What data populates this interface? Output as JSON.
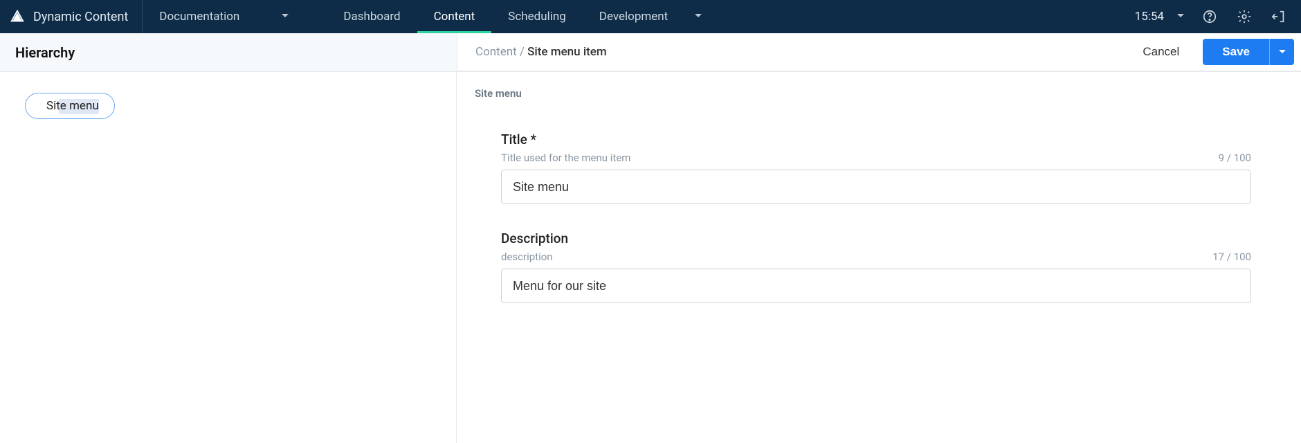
{
  "nav": {
    "brand": "Dynamic Content",
    "hub": "Documentation",
    "tabs": {
      "dashboard": "Dashboard",
      "content": "Content",
      "scheduling": "Scheduling",
      "development": "Development"
    },
    "clock": "15:54"
  },
  "sidebar": {
    "title": "Hierarchy",
    "node_label": "Site menu"
  },
  "editor": {
    "breadcrumb_root": "Content",
    "breadcrumb_current": "Site menu item",
    "cancel_label": "Cancel",
    "save_label": "Save",
    "schema_label": "Site menu",
    "fields": {
      "title": {
        "label": "Title *",
        "helper": "Title used for the menu item",
        "count": "9 / 100",
        "value": "Site menu"
      },
      "description": {
        "label": "Description",
        "helper": "description",
        "count": "17 / 100",
        "value": "Menu for our site"
      }
    }
  }
}
